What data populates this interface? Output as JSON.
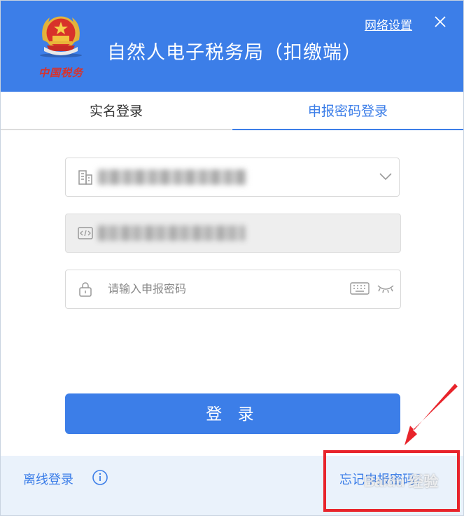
{
  "header": {
    "seal_text": "中国税务",
    "app_title": "自然人电子税务局（扣缴端）",
    "network_settings_label": "网络设置"
  },
  "tabs": [
    {
      "label": "实名登录",
      "active": false
    },
    {
      "label": "申报密码登录",
      "active": true
    }
  ],
  "form": {
    "password_placeholder": "请输入申报密码",
    "login_label": "登 录"
  },
  "footer": {
    "offline_login_label": "离线登录",
    "forgot_password_label": "忘记申报密码？"
  },
  "annotation": {
    "watermark_text": "Baidu 经验"
  },
  "colors": {
    "accent": "#3c7ee8",
    "footer_bg": "#eaf2fb",
    "highlight": "#e8242b"
  },
  "icons": [
    "national-emblem-icon",
    "close-icon",
    "building-icon",
    "chevron-down-icon",
    "tax-id-card-icon",
    "lock-icon",
    "keyboard-icon",
    "eye-closed-icon",
    "info-icon"
  ]
}
